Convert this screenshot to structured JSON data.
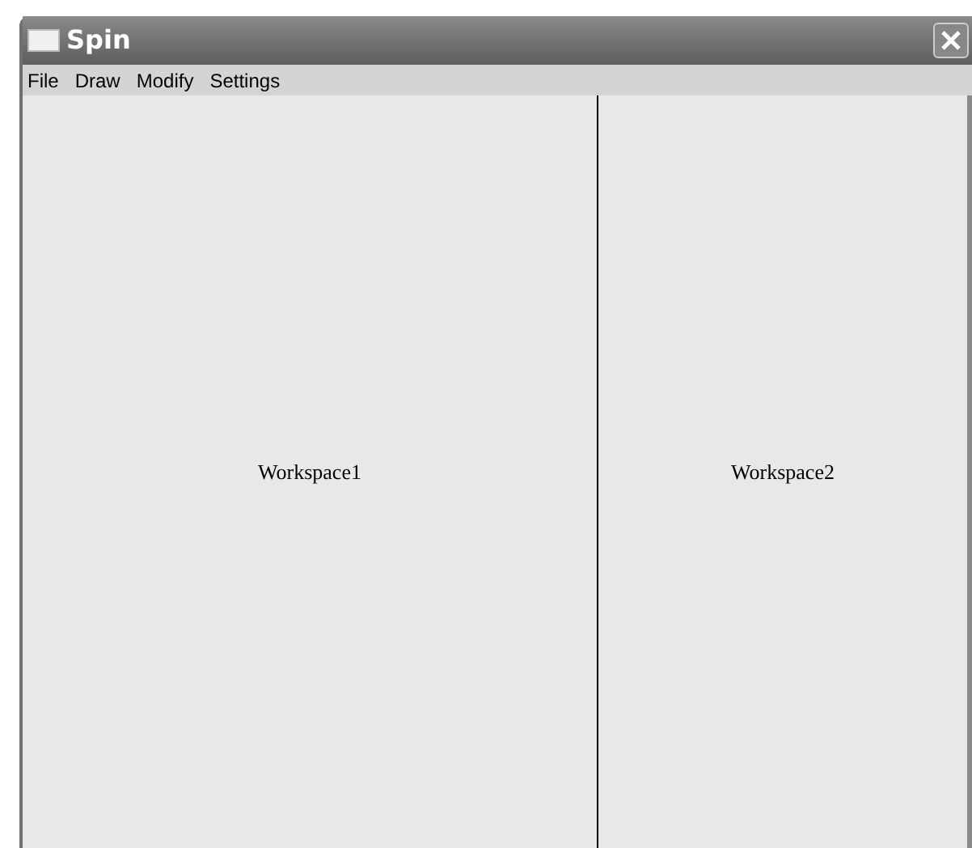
{
  "window": {
    "title": "Spin"
  },
  "menu": [
    "File",
    "Draw",
    "Modify",
    "Settings"
  ],
  "workspaces": [
    {
      "label": "Workspace1"
    },
    {
      "label": "Workspace2"
    }
  ]
}
